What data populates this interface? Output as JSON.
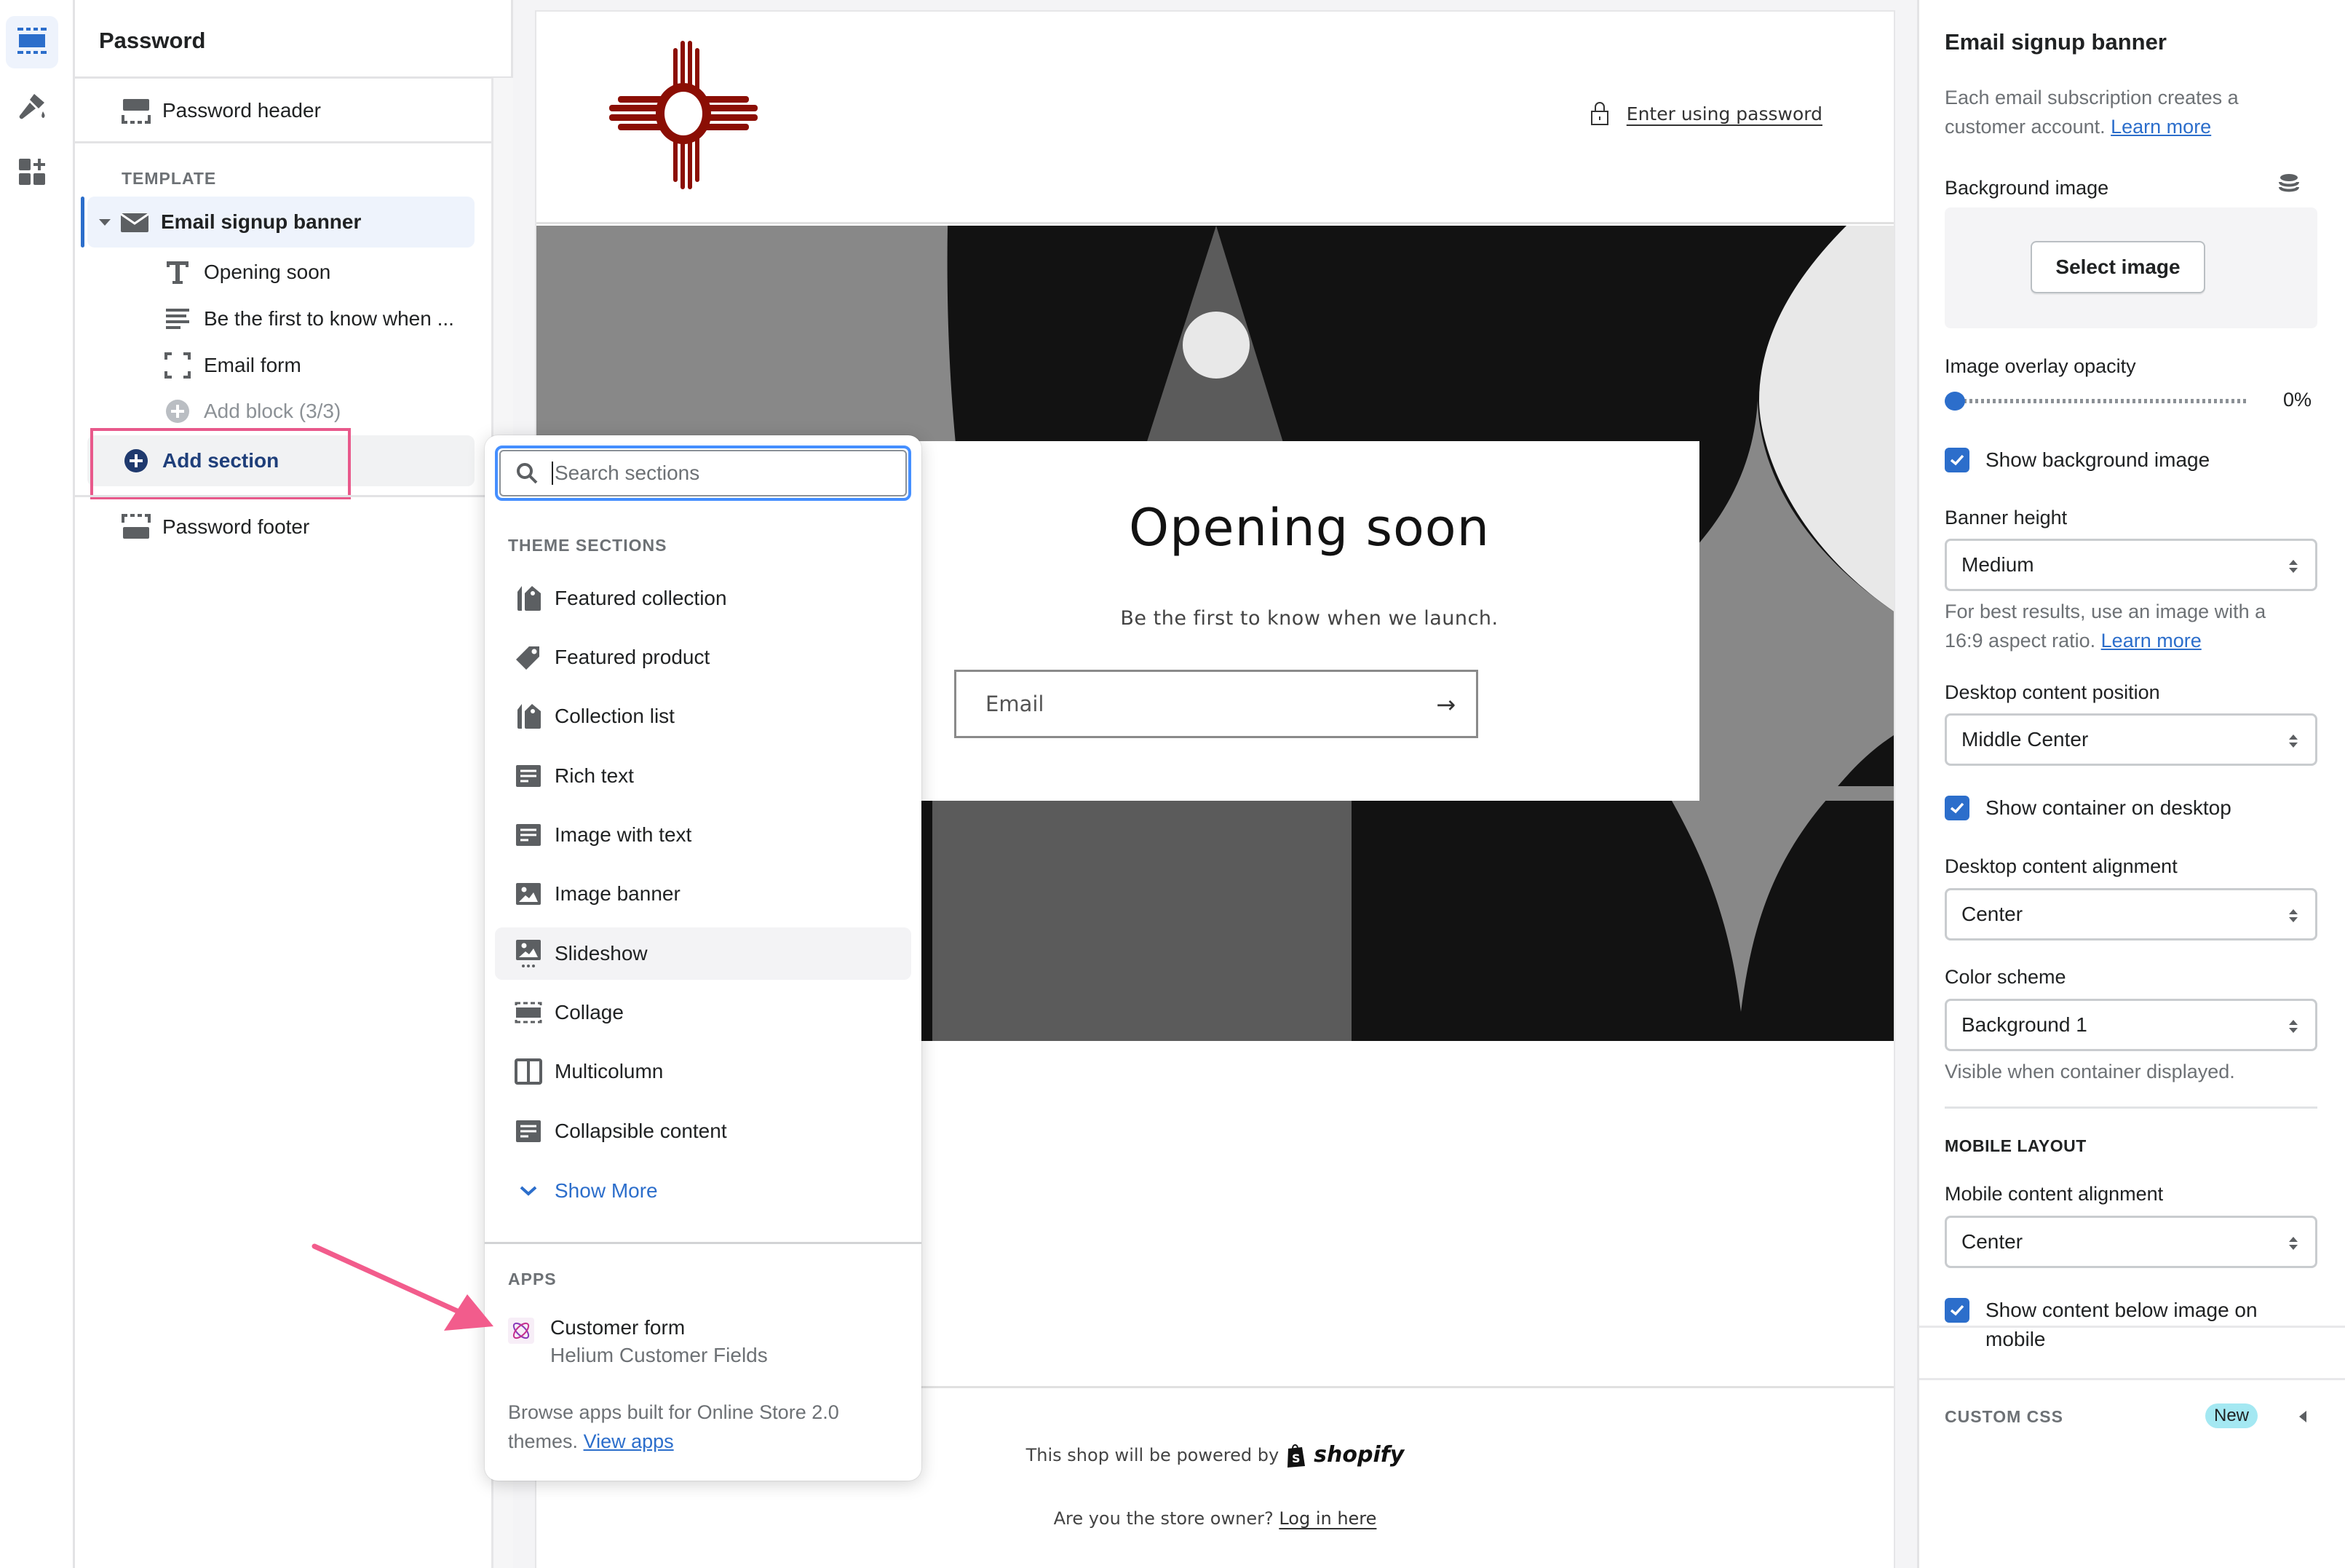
{
  "rail": {
    "items": [
      {
        "name": "sections",
        "icon": "sections-icon",
        "active": true
      },
      {
        "name": "theme-settings",
        "icon": "paintbrush-icon",
        "active": false
      },
      {
        "name": "app-embeds",
        "icon": "add-apps-icon",
        "active": false
      }
    ]
  },
  "left_panel": {
    "title": "Password",
    "header_section": "Password header",
    "template_label": "TEMPLATE",
    "selected_section": "Email signup banner",
    "blocks": [
      {
        "label": "Opening soon",
        "icon": "text-icon"
      },
      {
        "label": "Be the first to know when ...",
        "icon": "paragraph-icon"
      },
      {
        "label": "Email form",
        "icon": "email-form-icon"
      }
    ],
    "add_block": "Add block (3/3)",
    "add_section": "Add section",
    "footer_section": "Password footer"
  },
  "preview": {
    "enter_password": "Enter using password",
    "hero_title": "Opening soon",
    "hero_subtitle": "Be the first to know when we launch.",
    "email_placeholder": "Email",
    "footer_powered": "This shop will be powered by",
    "footer_brand": "shopify",
    "footer_owner": "Are you the store owner?",
    "footer_login": "Log in here",
    "colors": {
      "logo": "#8b0e04",
      "hero_dark": "#121212",
      "hero_mid": "#5b5b5b",
      "hero_gray": "#888888",
      "hero_light": "#e8e8e8"
    }
  },
  "popup": {
    "search_placeholder": "Search sections",
    "theme_sections_label": "THEME SECTIONS",
    "items": [
      {
        "label": "Featured collection",
        "icon": "collection-tags-icon"
      },
      {
        "label": "Featured product",
        "icon": "product-tag-icon"
      },
      {
        "label": "Collection list",
        "icon": "collection-tags-icon"
      },
      {
        "label": "Rich text",
        "icon": "text-block-icon"
      },
      {
        "label": "Image with text",
        "icon": "text-block-icon"
      },
      {
        "label": "Image banner",
        "icon": "image-icon"
      },
      {
        "label": "Slideshow",
        "icon": "slideshow-icon",
        "hover": true
      },
      {
        "label": "Collage",
        "icon": "collage-icon"
      },
      {
        "label": "Multicolumn",
        "icon": "columns-icon"
      },
      {
        "label": "Collapsible content",
        "icon": "text-block-icon"
      }
    ],
    "show_more": "Show More",
    "apps_label": "APPS",
    "app": {
      "title": "Customer form",
      "subtitle": "Helium Customer Fields"
    },
    "browse_text": "Browse apps built for Online Store 2.0 themes.",
    "browse_link": "View apps"
  },
  "right_panel": {
    "title": "Email signup banner",
    "description": "Each email subscription creates a customer account.",
    "learn_more": "Learn more",
    "background_image_label": "Background image",
    "select_image": "Select image",
    "overlay_label": "Image overlay opacity",
    "overlay_value": "0%",
    "overlay_fraction": 0,
    "show_bg_image": {
      "label": "Show background image",
      "checked": true
    },
    "banner_height": {
      "label": "Banner height",
      "value": "Medium"
    },
    "banner_hint": "For best results, use an image with a 16:9 aspect ratio.",
    "banner_hint_link": "Learn more",
    "desktop_position": {
      "label": "Desktop content position",
      "value": "Middle Center"
    },
    "show_container": {
      "label": "Show container on desktop",
      "checked": true
    },
    "desktop_alignment": {
      "label": "Desktop content alignment",
      "value": "Center"
    },
    "color_scheme": {
      "label": "Color scheme",
      "value": "Background 1"
    },
    "color_hint": "Visible when container displayed.",
    "mobile_layout_label": "MOBILE LAYOUT",
    "mobile_alignment": {
      "label": "Mobile content alignment",
      "value": "Center"
    },
    "show_below": {
      "label": "Show content below image on mobile",
      "checked": true
    },
    "custom_css_label": "CUSTOM CSS",
    "new_badge": "New"
  },
  "annotation": {
    "highlight_color": "#e8598b"
  }
}
